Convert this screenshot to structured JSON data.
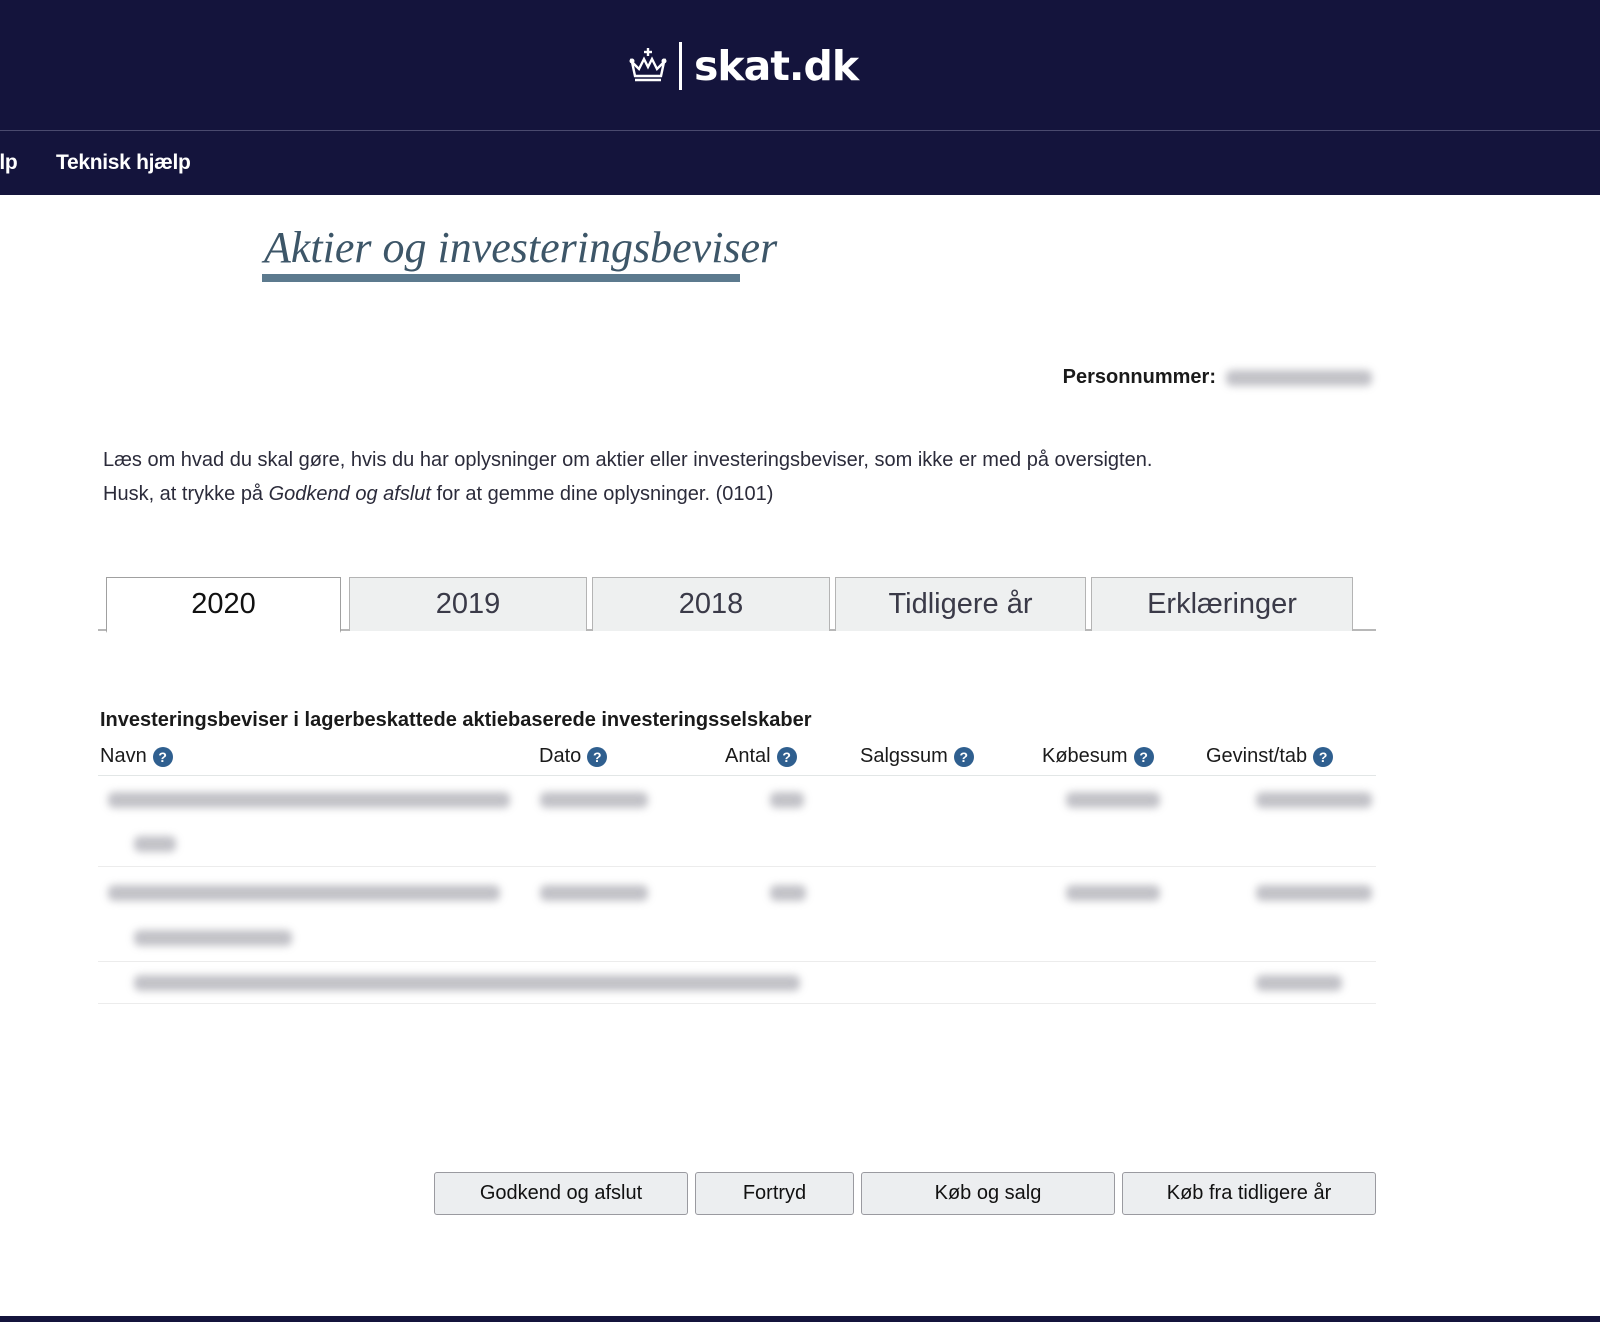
{
  "header": {
    "logo_text": "skat.dk",
    "logo_icon": "crown-icon",
    "background": "#14143c"
  },
  "nav": {
    "cut_item": "elp",
    "items": [
      "Teknisk hjælp"
    ]
  },
  "page": {
    "title": "Aktier og investeringsbeviser",
    "personnummer_label": "Personnummer:"
  },
  "intro": {
    "line1": "Læs om hvad du skal gøre, hvis du har oplysninger om aktier eller investeringsbeviser, som ikke er med på oversigten.",
    "line2_before": "Husk, at trykke på ",
    "line2_em": "Godkend og afslut",
    "line2_after": " for at gemme dine oplysninger. (0101)"
  },
  "tabs": [
    {
      "label": "2020",
      "active": true
    },
    {
      "label": "2019",
      "active": false
    },
    {
      "label": "2018",
      "active": false
    },
    {
      "label": "Tidligere år",
      "active": false
    },
    {
      "label": "Erklæringer",
      "active": false
    }
  ],
  "section": {
    "title": "Investeringsbeviser i lagerbeskattede aktiebaserede investeringsselskaber"
  },
  "table": {
    "columns": [
      "Navn",
      "Dato",
      "Antal",
      "Salgssum",
      "Købesum",
      "Gevinst/tab"
    ],
    "help_icon": "question-icon"
  },
  "buttons": {
    "approve": "Godkend og afslut",
    "undo": "Fortryd",
    "buy_sell": "Køb og salg",
    "buy_previous": "Køb fra tidligere år"
  },
  "colors": {
    "accent": "#5c7a8e",
    "help_icon": "#2f5f8f"
  }
}
